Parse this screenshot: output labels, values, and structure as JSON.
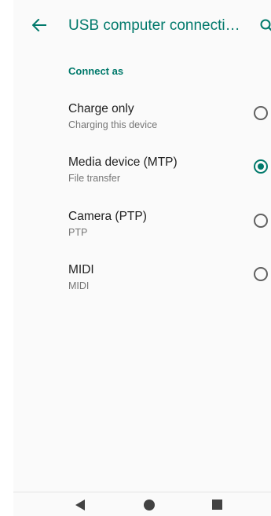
{
  "app_bar": {
    "title": "USB computer connecti…",
    "back_icon": "arrow-left-icon",
    "search_icon": "search-icon"
  },
  "section": {
    "header": "Connect as"
  },
  "options": [
    {
      "title": "Charge only",
      "subtitle": "Charging this device",
      "selected": false
    },
    {
      "title": "Media device (MTP)",
      "subtitle": "File transfer",
      "selected": true
    },
    {
      "title": "Camera (PTP)",
      "subtitle": "PTP",
      "selected": false
    },
    {
      "title": "MIDI",
      "subtitle": "MIDI",
      "selected": false
    }
  ],
  "nav_bar": {
    "back_icon": "nav-back-triangle-icon",
    "home_icon": "nav-home-circle-icon",
    "recents_icon": "nav-recents-square-icon"
  },
  "colors": {
    "accent": "#00796b",
    "background": "#fafafa",
    "text_primary": "#212121",
    "text_secondary": "#757575"
  }
}
